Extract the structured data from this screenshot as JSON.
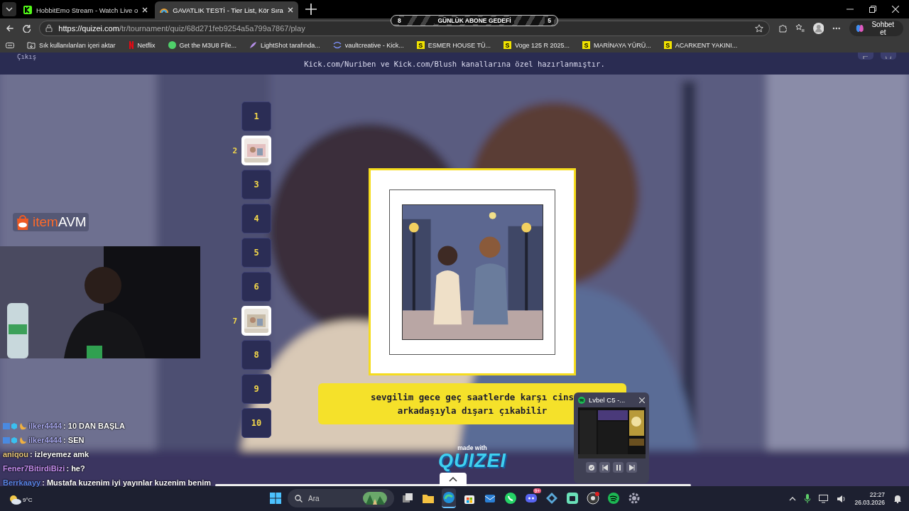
{
  "browser": {
    "tabs": [
      {
        "title": "HobbitEmo Stream - Watch Live o",
        "kind": "k",
        "selected": false
      },
      {
        "title": "GAVATLIK TESTİ - Tier List, Kör Sıra",
        "kind": "rainbow",
        "selected": true
      }
    ],
    "url_host": "https://quizei.com",
    "url_path": "/tr/tournament/quiz/68d271feb9254a5a799a7867/play",
    "chat_button": "Sohbet et",
    "bookmarks": [
      {
        "kind": "import",
        "label": "Sık kullanılanları içeri aktar"
      },
      {
        "kind": "netflix",
        "label": "Netflix"
      },
      {
        "kind": "circle",
        "label": "Get the M3U8 File..."
      },
      {
        "kind": "feather",
        "label": "LightShot tarafında..."
      },
      {
        "kind": "swirl",
        "label": "vaultcreative - Kick..."
      },
      {
        "kind": "letter",
        "letter": "S",
        "label": "ESMER HOUSE TÜ..."
      },
      {
        "kind": "letter",
        "letter": "S",
        "label": "Voge 125 R 2025..."
      },
      {
        "kind": "letter",
        "letter": "S",
        "label": "MARİNAYA YÜRÜ..."
      },
      {
        "kind": "letter",
        "letter": "S",
        "label": "ACARKENT YAKINI..."
      }
    ]
  },
  "quiz": {
    "exit": "Çıkış",
    "notice": "Kick.com/Nuriben ve Kick.com/Blush kanallarına özel hazırlanmıştır.",
    "steps": [
      {
        "number": "1",
        "kind": "number"
      },
      {
        "number": "2",
        "kind": "thumb"
      },
      {
        "number": "3",
        "kind": "number"
      },
      {
        "number": "4",
        "kind": "number"
      },
      {
        "number": "5",
        "kind": "number"
      },
      {
        "number": "6",
        "kind": "number"
      },
      {
        "number": "7",
        "kind": "thumb"
      },
      {
        "number": "8",
        "kind": "number"
      },
      {
        "number": "9",
        "kind": "number"
      },
      {
        "number": "10",
        "kind": "number"
      }
    ],
    "caption": "sevgilim gece geç saatlerde karşı cins arkadaşıyla dışarı çıkabilir",
    "made_with": "made with",
    "logo": "QUIZEI"
  },
  "overlay": {
    "goal": {
      "current": "8",
      "title": "GÜNLÜK ABONE GEDEFİ",
      "target": "5"
    },
    "brand": {
      "prefix": "item",
      "suffix": "AVM"
    },
    "chat": [
      {
        "user": "ilker4444",
        "color": "#a9a9ee",
        "badges": true,
        "text": ": 10 DAN BAŞLA"
      },
      {
        "user": "ilker4444",
        "color": "#a9a9ee",
        "badges": true,
        "text": ": SEN"
      },
      {
        "user": "aniqou",
        "color": "#e8c77a",
        "badges": false,
        "text": ": izleyemez amk"
      },
      {
        "user": "Fener7BitirdiBizi",
        "color": "#c58ef0",
        "badges": false,
        "text": ": he?"
      },
      {
        "user": "Berrkaayy",
        "color": "#5a86e6",
        "badges": false,
        "text": ": Mustafa kuzenim iyi yayınlar kuzenim benim"
      }
    ],
    "player": {
      "title": "Lvbel C5 -..."
    }
  },
  "taskbar": {
    "search_placeholder": "Ara",
    "weather": "9°C",
    "apps": [
      {
        "kind": "taskview",
        "active": false
      },
      {
        "kind": "folder",
        "active": false
      },
      {
        "kind": "edge",
        "active": true
      },
      {
        "kind": "store",
        "active": false
      },
      {
        "kind": "mail",
        "active": false
      },
      {
        "kind": "whatsapp",
        "active": false
      },
      {
        "kind": "discord",
        "active": false,
        "badge": "9+"
      },
      {
        "kind": "kodi",
        "active": false
      },
      {
        "kind": "greenapp",
        "active": false
      },
      {
        "kind": "obs",
        "active": false
      },
      {
        "kind": "spotify",
        "active": false
      },
      {
        "kind": "gear",
        "active": false
      }
    ],
    "time": "22:27",
    "date": "26.03.2026"
  }
}
